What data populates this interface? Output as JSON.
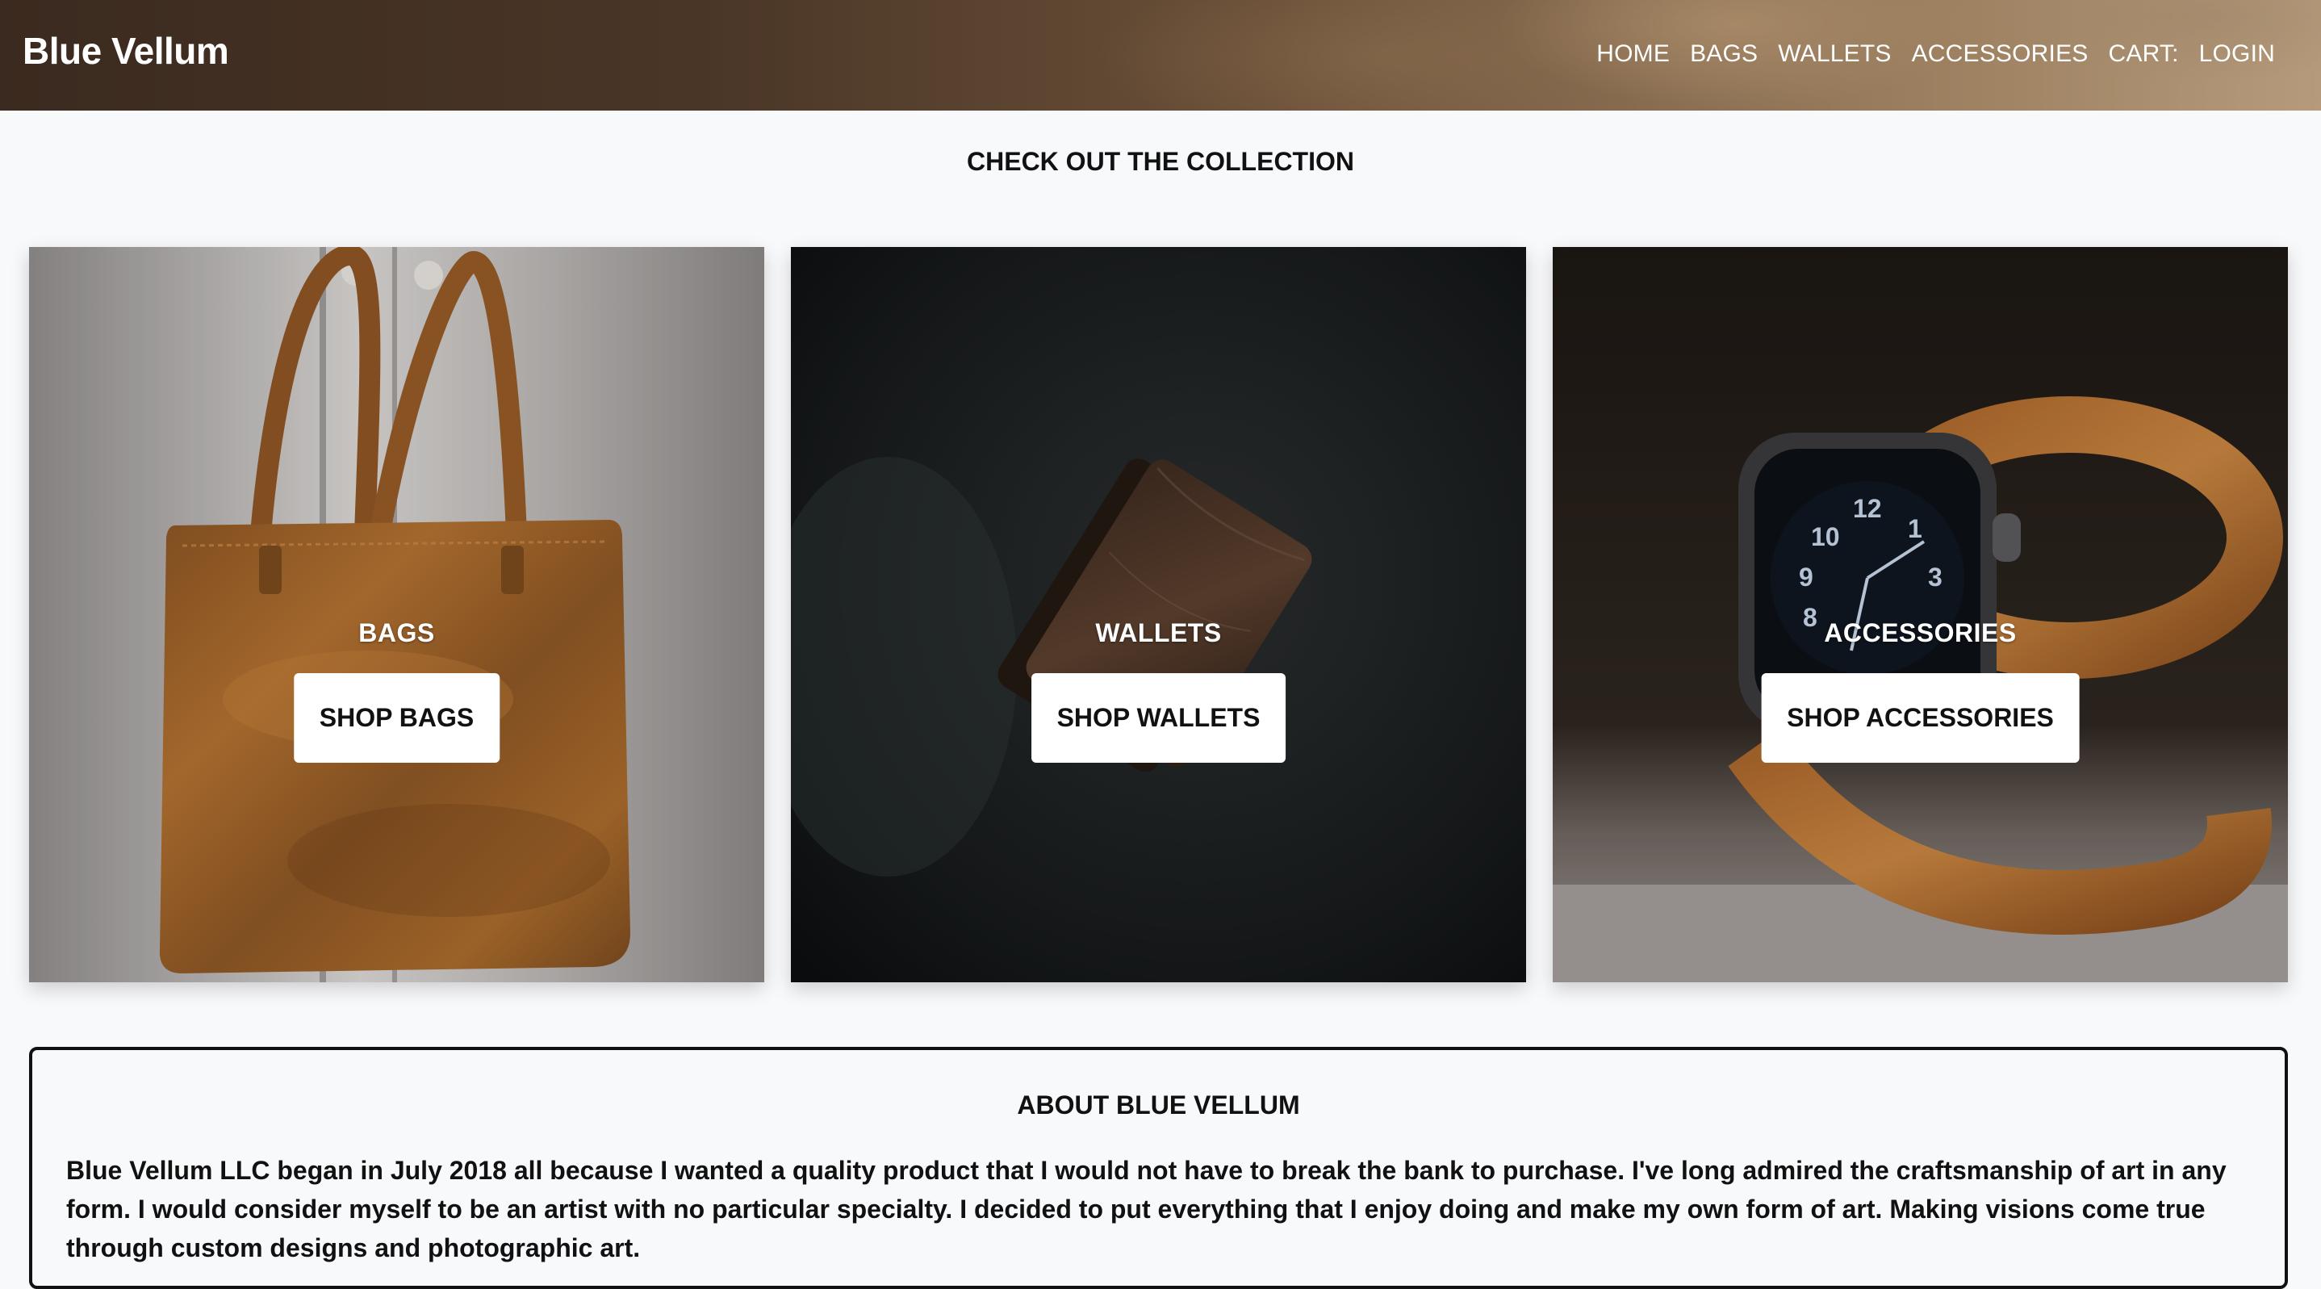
{
  "header": {
    "brand": "Blue Vellum",
    "nav": [
      "HOME",
      "BAGS",
      "WALLETS",
      "ACCESSORIES",
      "CART:",
      "LOGIN"
    ]
  },
  "collection": {
    "title": "CHECK OUT THE COLLECTION",
    "cards": [
      {
        "label": "BAGS",
        "button": "SHOP BAGS",
        "image": "leather-tote-bag"
      },
      {
        "label": "WALLETS",
        "button": "SHOP WALLETS",
        "image": "leather-wallet"
      },
      {
        "label": "ACCESSORIES",
        "button": "SHOP ACCESSORIES",
        "image": "watch-with-leather-band"
      }
    ]
  },
  "about": {
    "title": "ABOUT BLUE VELLUM",
    "text": "Blue Vellum LLC began in July 2018 all because I wanted a quality product that I would not have to break the bank to purchase. I've long admired the craftsmanship of art in any form. I would consider myself to be an artist with no particular specialty. I decided to put everything that I enjoy doing and make my own form of art. Making visions come true through custom designs and photographic art."
  }
}
